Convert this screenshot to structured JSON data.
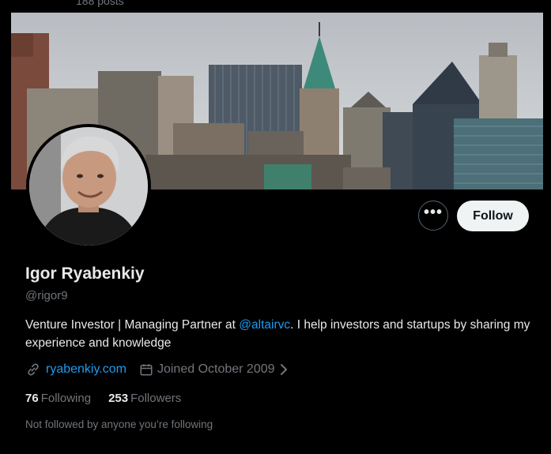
{
  "header": {
    "posts_count": "188 posts"
  },
  "profile": {
    "name": "Igor Ryabenkiy",
    "handle": "@rigor9",
    "bio_prefix": "Venture Investor | Managing Partner at ",
    "bio_mention": "@altairvc",
    "bio_suffix": ". I help investors and startups by sharing my experience and knowledge",
    "website": "ryabenkiy.com",
    "joined": "Joined October 2009",
    "following_count": "76",
    "following_label": "Following",
    "followers_count": "253",
    "followers_label": "Followers",
    "followed_by_note": "Not followed by anyone you’re following"
  },
  "actions": {
    "more_label": "•••",
    "follow_label": "Follow"
  },
  "icons": {
    "more": "more-icon",
    "link": "link-icon",
    "calendar": "calendar-icon",
    "chevron": "chevron-right-icon"
  },
  "colors": {
    "background": "#000000",
    "accent": "#1d9bf0",
    "text_primary": "#e7e9ea",
    "text_secondary": "#71767b",
    "follow_button_bg": "#eff3f4"
  }
}
